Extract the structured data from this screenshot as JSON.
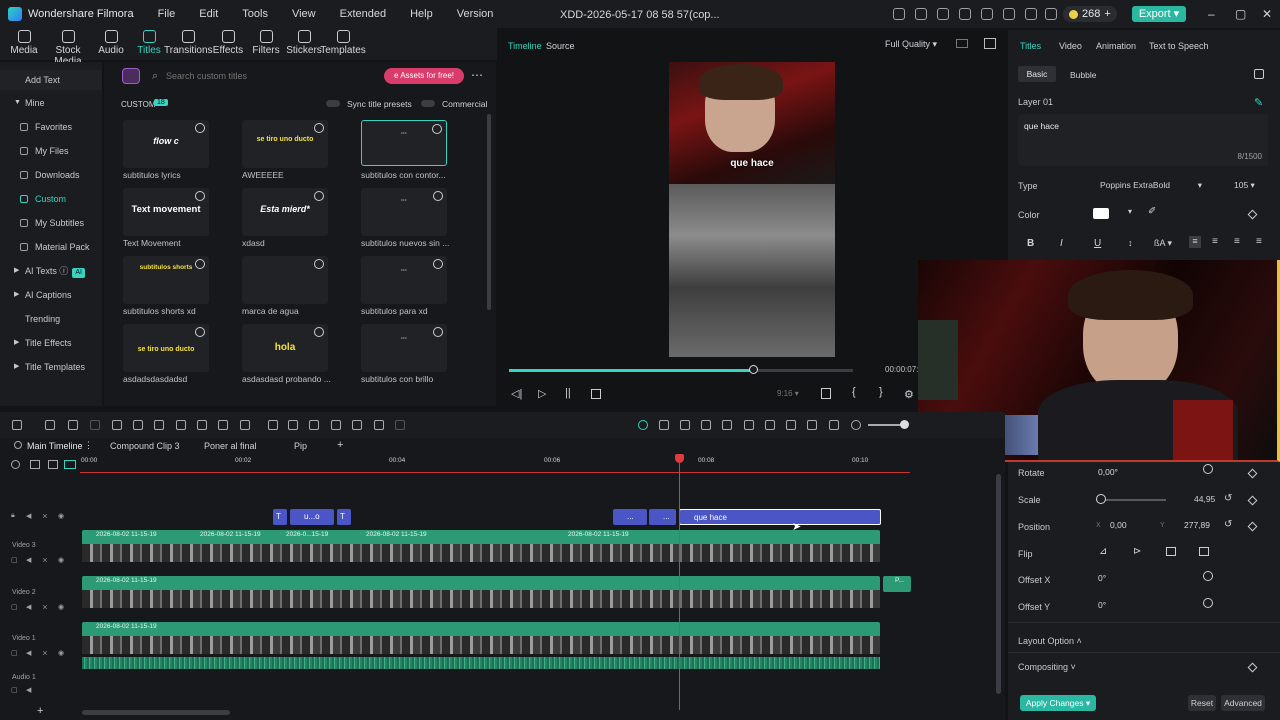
{
  "titlebar": {
    "app_name": "Wondershare Filmora",
    "menus": [
      "File",
      "Edit",
      "Tools",
      "View",
      "Extended",
      "Help",
      "Version"
    ],
    "project_name": "XDD-2026-05-17 08 58 57(cop...",
    "credits": "268",
    "export_label": "Export"
  },
  "toolbar": {
    "items": [
      {
        "label": "Media",
        "icon": "media-icon"
      },
      {
        "label": "Stock Media",
        "icon": "stock-media-icon"
      },
      {
        "label": "Audio",
        "icon": "audio-icon"
      },
      {
        "label": "Titles",
        "icon": "titles-icon"
      },
      {
        "label": "Transitions",
        "icon": "transitions-icon"
      },
      {
        "label": "Effects",
        "icon": "effects-icon"
      },
      {
        "label": "Filters",
        "icon": "filters-icon"
      },
      {
        "label": "Stickers",
        "icon": "stickers-icon"
      },
      {
        "label": "Templates",
        "icon": "templates-icon"
      }
    ],
    "active": "Titles"
  },
  "leftnav": {
    "add_text": "Add Text",
    "mine": "Mine",
    "items": [
      "Favorites",
      "My Files",
      "Downloads",
      "Custom",
      "My Subtitles",
      "Material Pack"
    ],
    "active": "Custom",
    "groups": [
      "AI Texts",
      "AI Captions",
      "Trending",
      "Title Effects",
      "Title Templates"
    ],
    "ai_badge": "AI"
  },
  "titles": {
    "search_placeholder": "Search custom titles",
    "assets_free": "e Assets for free!",
    "custom_label": "CUSTOM",
    "custom_count": "18",
    "sync_label": "Sync title presets",
    "commercial_label": "Commercial",
    "grid": [
      {
        "sample": "flow c",
        "label": "subtitulos lyrics"
      },
      {
        "sample": "se tiro uno ducto",
        "label": "AWEEEEE"
      },
      {
        "sample": "···",
        "label": "subtitulos con contor..."
      },
      {
        "sample": "Text movement",
        "label": "Text Movement"
      },
      {
        "sample": "Esta mierd*",
        "label": "xdasd"
      },
      {
        "sample": "···",
        "label": "subtitulos nuevos sin ..."
      },
      {
        "sample": "subtitulos shorts",
        "label": "subtitulos shorts xd"
      },
      {
        "sample": "",
        "label": "marca de agua"
      },
      {
        "sample": "···",
        "label": "subtitulos para xd"
      },
      {
        "sample": "se tiro uno ducto",
        "label": "asdadsdasdadsd"
      },
      {
        "sample": "hola",
        "label": "asdasdasd probando ..."
      },
      {
        "sample": "···",
        "label": "subtitulos con brillo"
      }
    ]
  },
  "preview": {
    "tabs": [
      "Timeline",
      "Source"
    ],
    "active_tab": "Timeline",
    "quality": "Full Quality",
    "caption": "que hace",
    "time": "00:00:07:",
    "ratio": "9:16",
    "progress": 0.71
  },
  "props": {
    "tabs": [
      "Titles",
      "Video",
      "Animation",
      "Text to Speech"
    ],
    "active_tab": "Titles",
    "subtabs": [
      "Basic",
      "Bubble"
    ],
    "layer": "Layer 01",
    "text": "que hace",
    "char_count": "8/1500",
    "type_label": "Type",
    "font": "Poppins ExtraBold",
    "size": "105",
    "color_label": "Color",
    "rotate_label": "Rotate",
    "rotate_value": "0,00°",
    "scale_label": "Scale",
    "scale_value": "44,95",
    "position_label": "Position",
    "pos_x_label": "X",
    "pos_x": "0,00",
    "pos_y_label": "Y",
    "pos_y": "277,89",
    "flip_label": "Flip",
    "offset_x_label": "Offset X",
    "offset_x": "0°",
    "offset_y_label": "Offset Y",
    "offset_y": "0°",
    "layout_option": "Layout Option",
    "compositing": "Compositing",
    "apply_changes": "Apply Changes",
    "reset": "Reset",
    "advanced": "Advanced"
  },
  "timeline": {
    "tabs": [
      "Main Timeline",
      "Compound Clip 3",
      "Poner al final",
      "Pip"
    ],
    "ruler": [
      "00:00",
      "00:02",
      "00:04",
      "00:06",
      "00:08",
      "00:10"
    ],
    "tracks": [
      "Video 3",
      "Video 2",
      "Video 1",
      "Audio 1"
    ],
    "title_clips": [
      "u...o",
      "que hace"
    ],
    "clip_name": "2026-08-02 11-15-19",
    "clip_name_short": "2026-0...15-19",
    "small_clip": "P...",
    "ellipsis": "..."
  }
}
